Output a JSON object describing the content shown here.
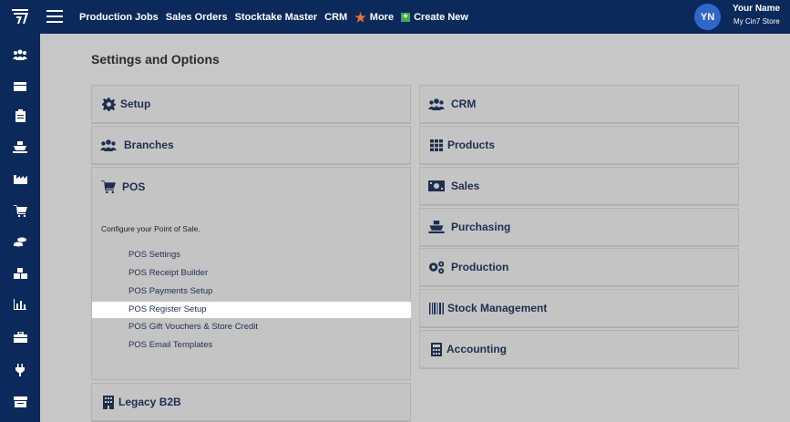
{
  "topbar": {
    "nav": [
      "Production Jobs",
      "Sales Orders",
      "Stocktake Master",
      "CRM",
      "More",
      "Create New"
    ],
    "avatar_initials": "YN",
    "user_name": "Your Name",
    "user_store": "My Cin7 Store"
  },
  "page": {
    "title": "Settings and Options"
  },
  "left_panels": {
    "setup": "Setup",
    "branches": "Branches",
    "pos": "POS",
    "legacy": "Legacy B2B"
  },
  "pos": {
    "description": "Configure your Point of Sale.",
    "links": [
      "POS Settings",
      "POS Receipt Builder",
      "POS Payments Setup",
      "POS Register Setup",
      "POS Gift Vouchers & Store Credit",
      "POS Email Templates"
    ]
  },
  "right_panels": [
    "CRM",
    "Products",
    "Sales",
    "Purchasing",
    "Production",
    "Stock Management",
    "Accounting"
  ],
  "colors": {
    "topbar": "#0b2a5b",
    "avatar": "#2f67c9",
    "more_star": "#e8733a",
    "create_plus": "#3fae49",
    "highlight": "#ffffff"
  }
}
